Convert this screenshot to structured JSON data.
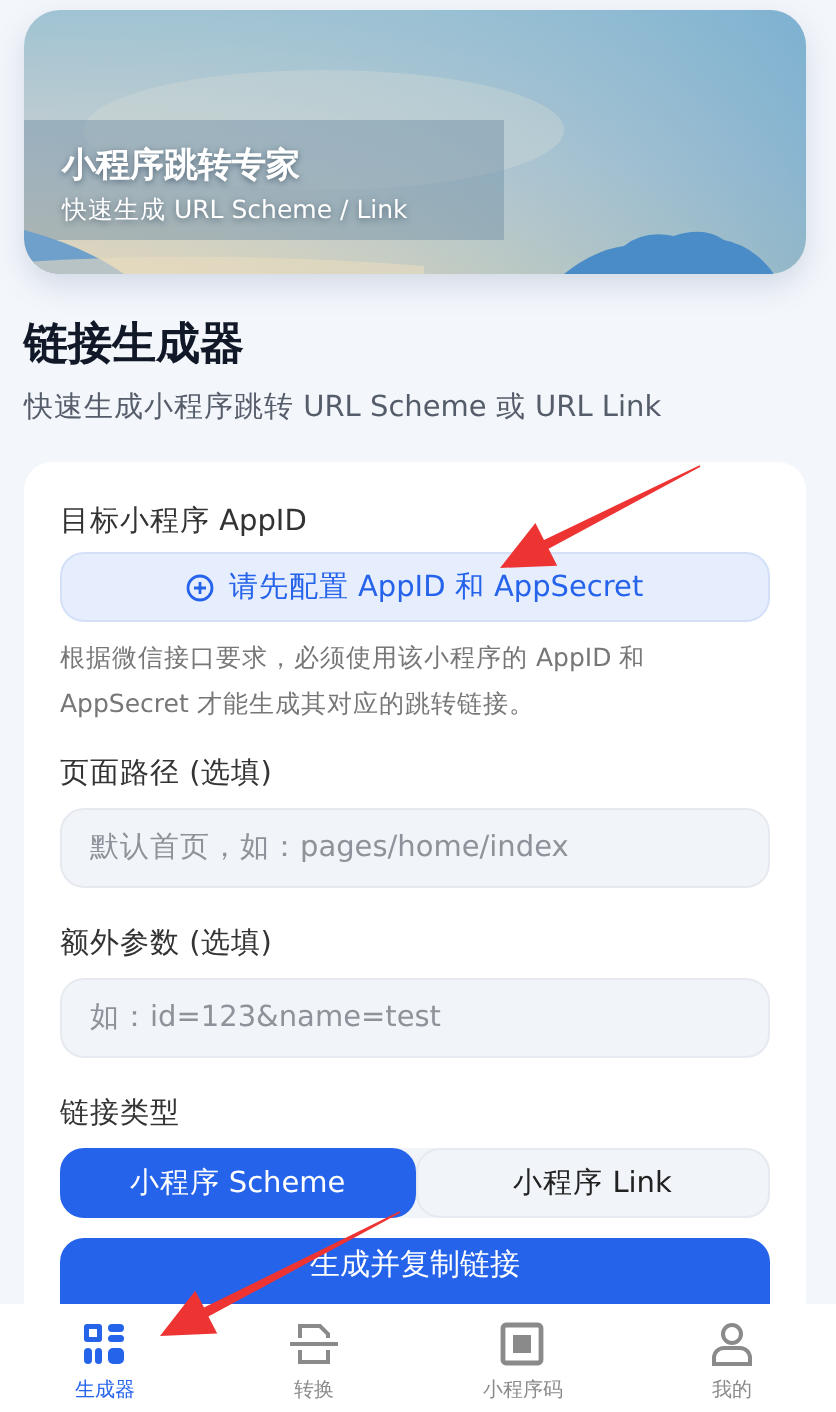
{
  "banner": {
    "kind": "picture",
    "title": "小程序跳转专家",
    "subtitle": "快速生成 URL Scheme / Link"
  },
  "header": {
    "title": "链接生成器",
    "subtitle": "快速生成小程序跳转 URL Scheme 或 URL Link"
  },
  "form": {
    "appid_label": "目标小程序 AppID",
    "config_button": "请先配置 AppID 和 AppSecret",
    "help_text": "根据微信接口要求，必须使用该小程序的 AppID 和 AppSecret 才能生成其对应的跳转链接。",
    "fields": [
      {
        "label": "页面路径 (选填)",
        "placeholder": "默认首页，如：pages/home/index"
      },
      {
        "label": "额外参数 (选填)",
        "placeholder": "如：id=123&name=test"
      }
    ],
    "type_label": "链接类型",
    "link_types": [
      {
        "label": "小程序 Scheme",
        "selected": true
      },
      {
        "label": "小程序 Link",
        "selected": false
      }
    ],
    "submit_button": "生成并复制链接"
  },
  "tab_bar": [
    {
      "kind": "grid",
      "label": "生成器",
      "selected": true
    },
    {
      "kind": "convert",
      "label": "转换",
      "selected": false
    },
    {
      "kind": "code",
      "label": "小程序码",
      "selected": false
    },
    {
      "kind": "user",
      "label": "我的",
      "selected": false
    }
  ],
  "annotations": [
    {
      "kind": "arrow"
    },
    {
      "kind": "arrow"
    }
  ]
}
